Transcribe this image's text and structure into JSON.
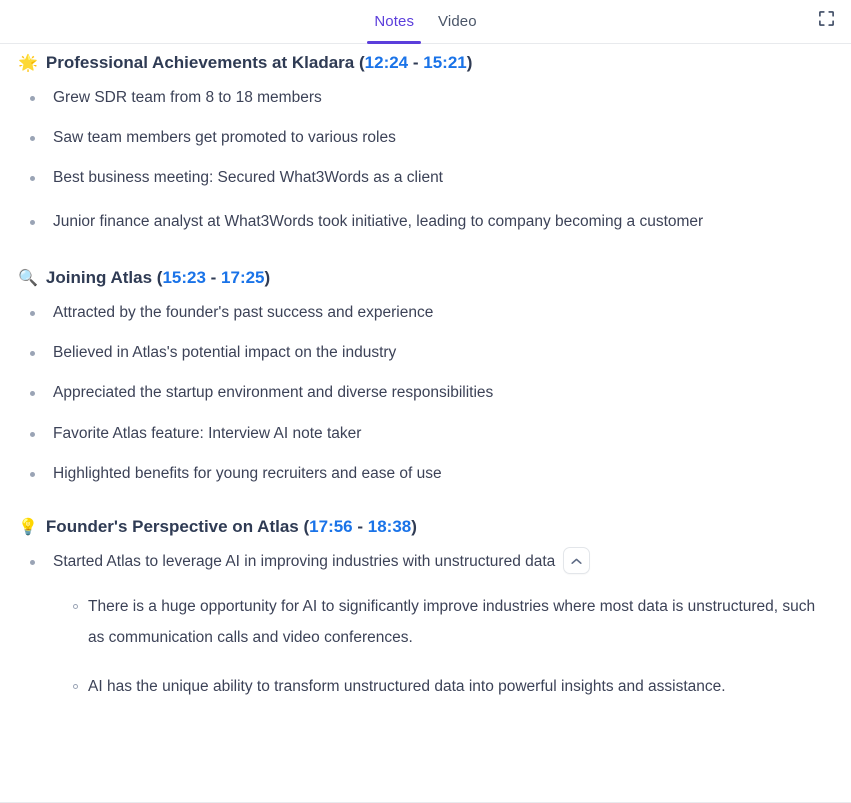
{
  "tabbar": {
    "tabs": [
      {
        "label": "Notes",
        "active": true
      },
      {
        "label": "Video",
        "active": false
      }
    ],
    "fullscreen_icon": "fullscreen-expand-icon",
    "active_color": "#5b3edb",
    "inactive_color": "#4a5568"
  },
  "colors": {
    "link": "#1a73e8",
    "heading": "#2f3b54",
    "body": "#3c4257",
    "bullet": "#9aa4b5",
    "divider": "#e8eaed"
  },
  "notes": {
    "sections": [
      {
        "emoji": "🌟",
        "emoji_name": "glowing-star-icon",
        "title": "Professional Achievements at Kladara",
        "time_start": "12:24",
        "time_end": "15:21",
        "bullets": [
          {
            "text": "Grew SDR team from 8 to 18 members",
            "wrapped": false
          },
          {
            "text": "Saw team members get promoted to various roles",
            "wrapped": false
          },
          {
            "text": "Best business meeting: Secured What3Words as a client",
            "wrapped": false
          },
          {
            "text": "Junior finance analyst at What3Words took initiative, leading to company becoming a customer",
            "wrapped": true
          }
        ],
        "subbullets": []
      },
      {
        "emoji": "🔍",
        "emoji_name": "magnifying-glass-icon",
        "title": "Joining Atlas",
        "time_start": "15:23",
        "time_end": "17:25",
        "bullets": [
          {
            "text": "Attracted by the founder's past success and experience",
            "wrapped": false
          },
          {
            "text": "Believed in Atlas's potential impact on the industry",
            "wrapped": false
          },
          {
            "text": "Appreciated the startup environment and diverse responsibilities",
            "wrapped": false
          },
          {
            "text": "Favorite Atlas feature: Interview AI note taker",
            "wrapped": false
          },
          {
            "text": "Highlighted benefits for young recruiters and ease of use",
            "wrapped": false
          }
        ],
        "subbullets": []
      },
      {
        "emoji": "💡",
        "emoji_name": "light-bulb-icon",
        "title": "Founder's Perspective on Atlas",
        "time_start": "17:56",
        "time_end": "18:38",
        "bullets": [
          {
            "text": "Started Atlas to leverage AI in improving industries with unstructured data",
            "wrapped": false,
            "has_collapse_button": true
          }
        ],
        "subbullets": [
          {
            "text": "There is a huge opportunity for AI to significantly improve industries where most data is unstructured, such as communication calls and video conferences."
          },
          {
            "text": "AI has the unique ability to transform unstructured data into powerful insights and assistance."
          }
        ]
      }
    ],
    "collapse_button_icon": "chevron-up-icon"
  }
}
